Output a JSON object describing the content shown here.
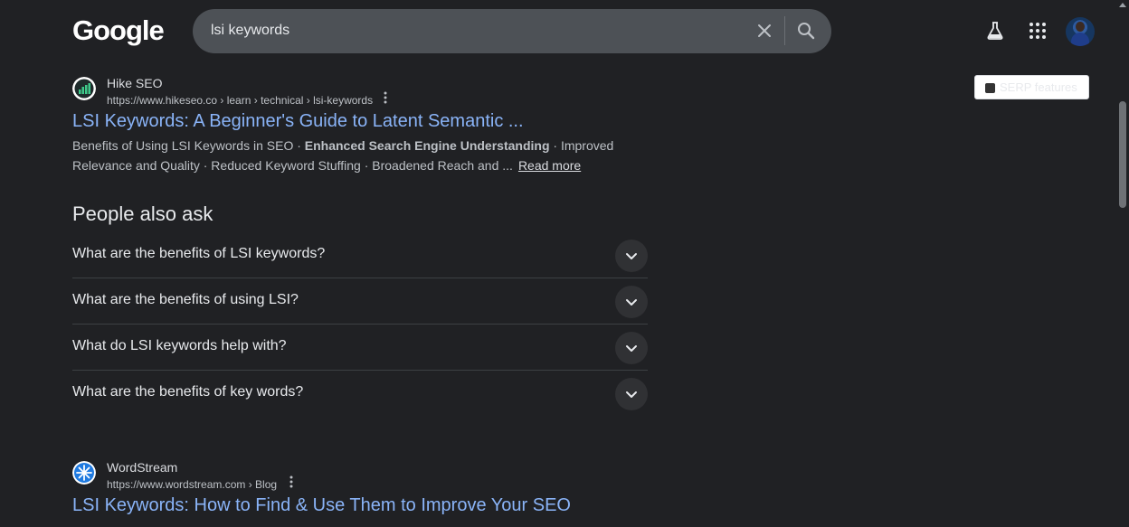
{
  "header": {
    "logo": "Google",
    "search_value": "lsi keywords",
    "icons": [
      "close-icon",
      "search-icon",
      "flask-icon",
      "apps-grid-icon"
    ]
  },
  "serp_features": {
    "label": "SERP features"
  },
  "results": [
    {
      "site_name": "Hike SEO",
      "url": "https://www.hikeseo.co › learn › technical › lsi-keywords",
      "title": "LSI Keywords: A Beginner's Guide to Latent Semantic ...",
      "snippet_pre": "Benefits of Using LSI Keywords in SEO · ",
      "snippet_bold": "Enhanced Search Engine Understanding",
      "snippet_post": " · Improved Relevance and Quality · Reduced Keyword Stuffing · Broadened Reach and ...",
      "read_more": "Read more"
    },
    {
      "site_name": "WordStream",
      "url": "https://www.wordstream.com › Blog",
      "title": "LSI Keywords: How to Find & Use Them to Improve Your SEO"
    }
  ],
  "people_also_ask": {
    "title": "People also ask",
    "questions": [
      "What are the benefits of LSI keywords?",
      "What are the benefits of using LSI?",
      "What do LSI keywords help with?",
      "What are the benefits of key words?"
    ]
  },
  "colors": {
    "background": "#202124",
    "link": "#8ab4f8",
    "search_box": "#4d5156"
  }
}
